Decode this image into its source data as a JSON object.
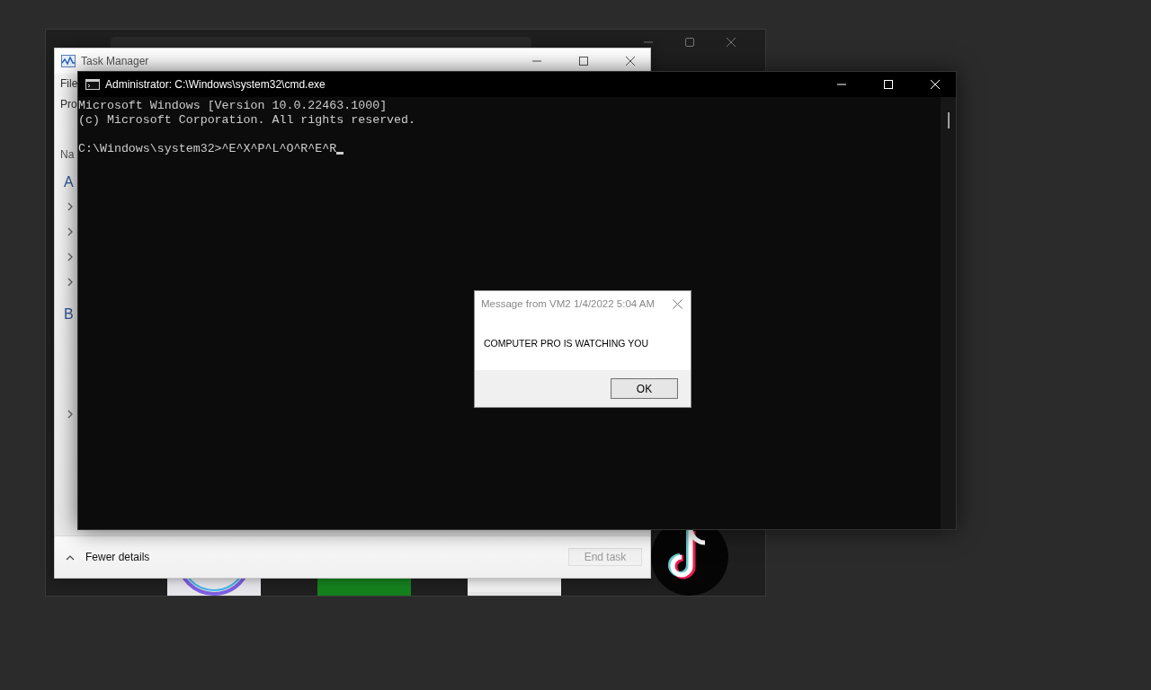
{
  "task_manager": {
    "title": "Task Manager",
    "menu": "File",
    "tab": "Pro",
    "column": "Na",
    "groups": [
      {
        "label": "A",
        "rows": [
          {
            "kind": "expandable",
            "expanded": false
          },
          {
            "kind": "expandable",
            "expanded": false
          },
          {
            "kind": "expandable",
            "expanded": false
          },
          {
            "kind": "expandable",
            "expanded": false
          }
        ]
      },
      {
        "label": "B",
        "rows": [
          {
            "kind": "plain"
          },
          {
            "kind": "plain"
          },
          {
            "kind": "plain"
          },
          {
            "kind": "expandable",
            "expanded": false
          }
        ]
      }
    ],
    "details_toggle": "Fewer details",
    "end_task": {
      "label": "End task",
      "disabled": true
    }
  },
  "cmd": {
    "title": "Administrator: C:\\Windows\\system32\\cmd.exe",
    "lines": [
      "Microsoft Windows [Version 10.0.22463.1000]",
      "(c) Microsoft Corporation. All rights reserved."
    ],
    "prompt": "C:\\Windows\\system32>^E^X^P^L^O^R^E^R"
  },
  "dialog": {
    "title": "Message from VM2 1/4/2022 5:04 AM",
    "message": "COMPUTER PRO IS WATCHING YOU",
    "button": "OK"
  }
}
